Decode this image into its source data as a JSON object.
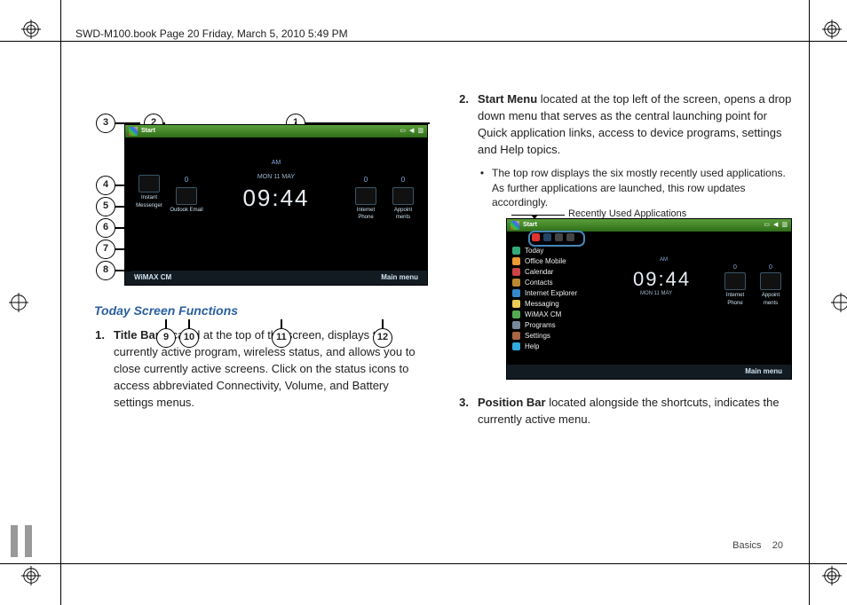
{
  "header": {
    "path": "SWD-M100.book  Page 20  Friday, March 5, 2010  5:49 PM"
  },
  "footer": {
    "section": "Basics",
    "page": "20"
  },
  "left": {
    "section_heading": "Today Screen Functions",
    "item1_num": "1.",
    "item1_bold": "Title Bar",
    "item1_rest": " located at the top of the screen, displays the currently active program, wireless status, and allows you to close currently active screens. Click on the status icons to access abbreviated Connectivity, Volume, and Battery settings menus.",
    "callouts": {
      "c1": "1",
      "c2": "2",
      "c3": "3",
      "c4": "4",
      "c5": "5",
      "c6": "6",
      "c7": "7",
      "c8": "8",
      "c9": "9",
      "c10": "10",
      "c11": "11",
      "c12": "12"
    }
  },
  "right": {
    "item2_num": "2.",
    "item2_bold": "Start Menu",
    "item2_rest": " located at the top left of the screen, opens a drop down menu that serves as the central launching point for Quick application links, access to device programs, settings and Help topics.",
    "bullet1": "The top row displays the six mostly recently used applications. As further applications are launched, this row updates accordingly.",
    "recent_label": "Recently Used Applications",
    "item3_num": "3.",
    "item3_bold": "Position Bar",
    "item3_rest": " located alongside the shortcuts, indicates the currently active menu."
  },
  "device1": {
    "start": "Start",
    "app1": "Instant Messenger",
    "app2": "Outlook Email",
    "app3": "Internet Phone",
    "app4": "Appoint ments",
    "time": "09:44",
    "am": "AM",
    "date": "MON 11 MAY",
    "bl": "WiMAX CM",
    "br": "Main menu",
    "count0": "0"
  },
  "device2": {
    "start": "Start",
    "menu": [
      "Today",
      "Office Mobile",
      "Calendar",
      "Contacts",
      "Internet Explorer",
      "Messaging",
      "WiMAX CM",
      "Programs",
      "Settings",
      "Help"
    ],
    "time": "09:44",
    "am": "AM",
    "date": "MON 11 MAY",
    "app3": "Internet Phone",
    "app4": "Appoint ments",
    "br": "Main menu",
    "count0": "0"
  }
}
